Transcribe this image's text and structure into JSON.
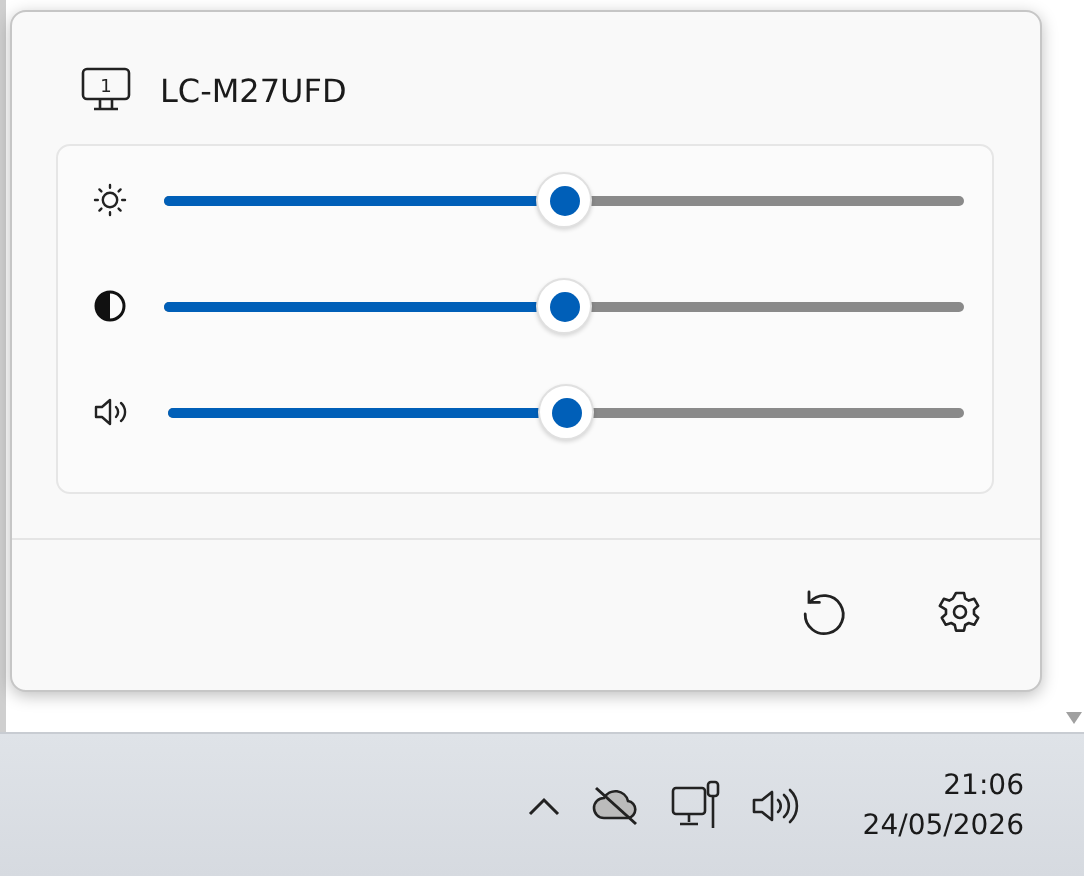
{
  "flyout": {
    "monitor_number": "1",
    "title": "LC-M27UFD",
    "sliders": [
      {
        "kind": "brightness",
        "level": 0.5
      },
      {
        "kind": "contrast",
        "level": 0.5
      },
      {
        "kind": "volume",
        "level": 0.5
      }
    ]
  },
  "taskbar": {
    "time": "21:06",
    "date": "24/05/2026"
  }
}
